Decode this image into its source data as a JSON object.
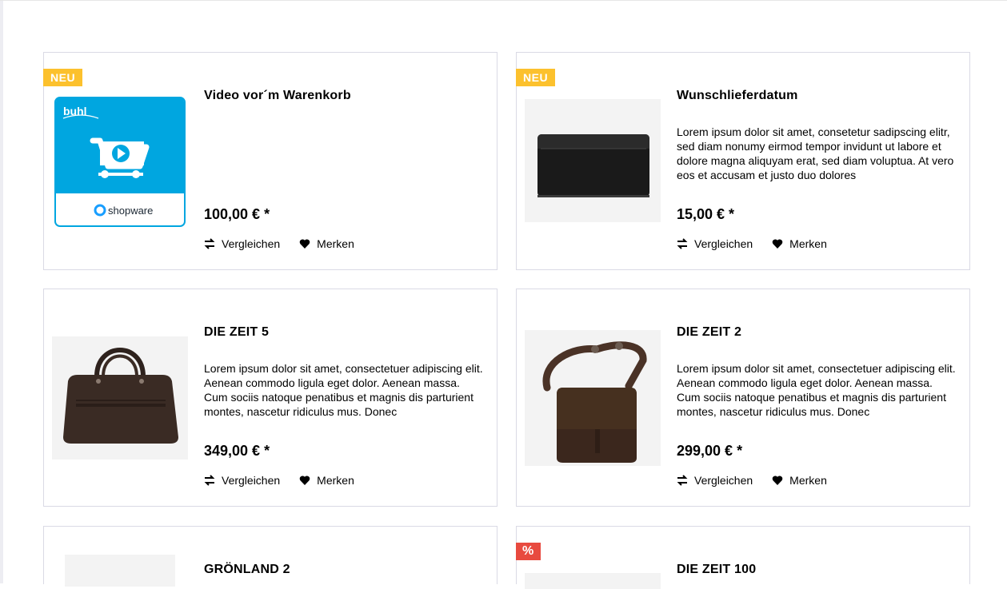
{
  "products": [
    {
      "title": "Video vor´m Warenkorb",
      "badge": "NEU",
      "description": "",
      "price": "100,00 € *",
      "image": "buhl-shopware-plugin-logo",
      "compare_label": "Vergleichen",
      "wishlist_label": "Merken"
    },
    {
      "title": "Wunschlieferdatum",
      "badge": "NEU",
      "description": "Lorem ipsum dolor sit amet, consetetur sadipscing elitr, sed diam nonumy eirmod tempor invidunt ut labore et dolore magna aliquyam erat, sed diam voluptua. At vero eos et accusam et justo duo dolores",
      "price": "15,00 € *",
      "image": "black-leather-wallet",
      "compare_label": "Vergleichen",
      "wishlist_label": "Merken"
    },
    {
      "title": "DIE ZEIT 5",
      "badge": "",
      "description": "Lorem ipsum dolor sit amet, consectetuer adipiscing elit. Aenean commodo ligula eget dolor. Aenean massa. Cum sociis natoque penatibus et magnis dis parturient montes, nascetur ridiculus mus. Donec",
      "price": "349,00 € *",
      "image": "brown-leather-briefcase",
      "compare_label": "Vergleichen",
      "wishlist_label": "Merken"
    },
    {
      "title": "DIE ZEIT 2",
      "badge": "",
      "description": "Lorem ipsum dolor sit amet, consectetuer adipiscing elit. Aenean commodo ligula eget dolor. Aenean massa. Cum sociis natoque penatibus et magnis dis parturient montes, nascetur ridiculus mus. Donec",
      "price": "299,00 € *",
      "image": "brown-leather-messenger-bag",
      "compare_label": "Vergleichen",
      "wishlist_label": "Merken"
    },
    {
      "title": "GRÖNLAND 2",
      "badge": "",
      "image": "product-image-placeholder"
    },
    {
      "title": "DIE ZEIT 100",
      "badge": "%",
      "image": "product-image-placeholder"
    }
  ],
  "logo": {
    "brand_text": "buhl",
    "platform_text": "shopware"
  },
  "colors": {
    "badge_new": "#fcc12d",
    "badge_discount": "#e84a3f",
    "card_border": "#dadae5",
    "logo_blue": "#00a6e0"
  },
  "icons": {
    "compare": "compare-arrows-icon",
    "wishlist": "heart-icon"
  }
}
